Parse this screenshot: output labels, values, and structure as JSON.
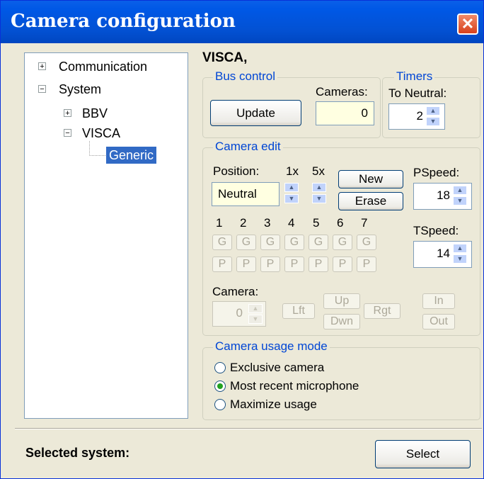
{
  "window": {
    "title": "Camera configuration",
    "close": "✕"
  },
  "tree": {
    "expand": "+",
    "collapse": "−",
    "items": [
      "Communication",
      "System",
      "BBV",
      "VISCA",
      "Generic"
    ]
  },
  "heading": "VISCA,",
  "bus": {
    "label": "Bus control",
    "update": "Update",
    "cameras_label": "Cameras:",
    "cameras_value": "0"
  },
  "timers": {
    "label": "Timers",
    "to_neutral_label": "To Neutral:",
    "to_neutral_value": "2"
  },
  "edit": {
    "label": "Camera edit",
    "position_label": "Position:",
    "x1_label": "1x",
    "x5_label": "5x",
    "position_value": "Neutral",
    "new": "New",
    "erase": "Erase",
    "pspeed_label": "PSpeed:",
    "pspeed_value": "18",
    "tspeed_label": "TSpeed:",
    "tspeed_value": "14",
    "presets": [
      "1",
      "2",
      "3",
      "4",
      "5",
      "6",
      "7"
    ],
    "g": "G",
    "p": "P",
    "camera_label": "Camera:",
    "camera_value": "0",
    "lft": "Lft",
    "up": "Up",
    "dwn": "Dwn",
    "rgt": "Rgt",
    "in": "In",
    "out": "Out"
  },
  "usage": {
    "label": "Camera usage mode",
    "options": [
      "Exclusive camera",
      "Most recent microphone",
      "Maximize usage"
    ],
    "selected": "Most recent microphone"
  },
  "footer": {
    "selected_system_label": "Selected system:",
    "select": "Select"
  },
  "colors": {
    "title_bar": "#0054e3",
    "group_label": "#0046d5",
    "selection": "#316ac5",
    "field_bg": "#ffffe1",
    "radio_dot": "#21a121"
  },
  "icons": {
    "spin_up": "up-arrow-icon",
    "spin_down": "down-arrow-icon"
  }
}
